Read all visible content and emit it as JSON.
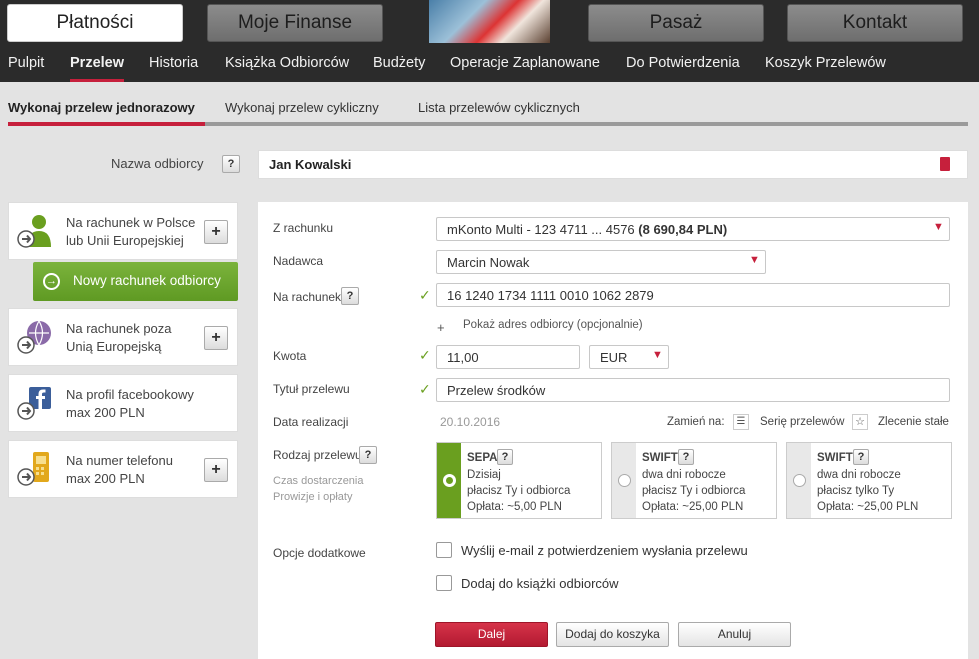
{
  "top": {
    "buttons": [
      "Płatności",
      "Moje Finanse",
      "Pasaż",
      "Kontakt"
    ]
  },
  "nav": {
    "items": [
      "Pulpit",
      "Przelew",
      "Historia",
      "Książka Odbiorców",
      "Budżety",
      "Operacje Zaplanowane",
      "Do Potwierdzenia",
      "Koszyk Przelewów"
    ]
  },
  "subtabs": [
    "Wykonaj przelew jednorazowy",
    "Wykonaj przelew cykliczny",
    "Lista przelewów cyklicznych"
  ],
  "recipient": {
    "label": "Nazwa odbiorcy",
    "help": "?",
    "value": "Jan Kowalski"
  },
  "sidebar": {
    "cards": [
      {
        "line1": "Na rachunek w Polsce",
        "line2": "lub Unii Europejskiej",
        "button": "+"
      },
      {
        "line1": "Na rachunek poza",
        "line2": "Unią Europejską",
        "button": "+"
      },
      {
        "line1": "Na profil facebookowy",
        "line2": "max 200 PLN"
      },
      {
        "line1": "Na numer telefonu",
        "line2": "max 200 PLN",
        "button": "+"
      }
    ],
    "new_account_label": "Nowy rachunek odbiorcy"
  },
  "form": {
    "from_label": "Z rachunku",
    "from_account": "mKonto Multi - 123 4711 ... 4576",
    "from_balance": "(8 690,84 PLN)",
    "sender_label": "Nadawca",
    "sender_value": "Marcin Nowak",
    "to_label": "Na rachunek",
    "to_help": "?",
    "to_value": "16 1240 1734 1111 0010 1062 2879",
    "show_address": "Pokaż adres odbiorcy (opcjonalnie)",
    "show_address_plus": "+",
    "amount_label": "Kwota",
    "amount_value": "11,00",
    "currency": "EUR",
    "title_label": "Tytuł przelewu",
    "title_value": "Przelew środków",
    "date_label": "Data realizacji",
    "date_value": "20.10.2016",
    "change_to": "Zamień na:",
    "series_label": "Serię przelewów",
    "standing_label": "Zlecenie stałe",
    "type_label": "Rodzaj przelewu",
    "type_help": "?",
    "delivery_label": "Czas dostarczenia",
    "fees_label": "Prowizje i opłaty",
    "types": [
      {
        "name": "SEPA",
        "help": "?",
        "time": "Dzisiaj",
        "payer": "płacisz Ty i odbiorca",
        "fee": "Opłata: ~5,00 PLN",
        "selected": true
      },
      {
        "name": "SWIFT",
        "help": "?",
        "time": "dwa dni robocze",
        "payer": "płacisz Ty i odbiorca",
        "fee": "Opłata: ~25,00 PLN",
        "selected": false
      },
      {
        "name": "SWIFT",
        "help": "?",
        "time": "dwa dni robocze",
        "payer": "płacisz tylko Ty",
        "fee": "Opłata: ~25,00 PLN",
        "selected": false
      }
    ],
    "options_label": "Opcje dodatkowe",
    "option_email": "Wyślij e-mail z potwierdzeniem wysłania przelewu",
    "option_book": "Dodaj do książki odbiorców",
    "buttons": {
      "next": "Dalej",
      "basket": "Dodaj do koszyka",
      "cancel": "Anuluj"
    }
  },
  "colors": {
    "accent": "#c6203c",
    "green": "#6a9f1f",
    "dark": "#2b2b2b"
  }
}
